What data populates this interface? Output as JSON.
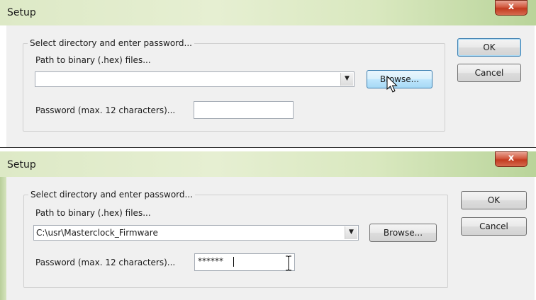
{
  "dialogs": [
    {
      "title": "Setup",
      "close_label": "x",
      "group_label": "Select directory and enter password...",
      "path_label": "Path to binary (.hex) files...",
      "path_value": "",
      "browse_label": "Browse...",
      "password_label": "Password (max. 12 characters)...",
      "password_value": "",
      "ok_label": "OK",
      "cancel_label": "Cancel"
    },
    {
      "title": "Setup",
      "close_label": "x",
      "group_label": "Select directory and enter password...",
      "path_label": "Path to binary (.hex) files...",
      "path_value": "C:\\usr\\Masterclock_Firmware",
      "browse_label": "Browse...",
      "password_label": "Password (max. 12 characters)...",
      "password_value": "******",
      "ok_label": "OK",
      "cancel_label": "Cancel"
    }
  ],
  "colors": {
    "titlebar_accent": "#b9d49a",
    "close_button": "#c23a1f",
    "dialog_body": "#f0f0f0",
    "button_hover": "#bee6fd"
  }
}
